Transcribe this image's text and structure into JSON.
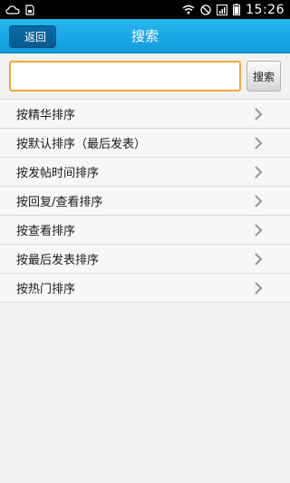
{
  "status_bar": {
    "time": "15:26",
    "icons": [
      "cloud-icon",
      "sim-icon",
      "wifi-icon",
      "do-not-disturb-icon",
      "signal-icon",
      "battery-icon"
    ]
  },
  "nav": {
    "back_label": "返回",
    "title": "搜索"
  },
  "search": {
    "value": "",
    "placeholder": "",
    "button_label": "搜索"
  },
  "sort_options": [
    {
      "label": "按精华排序"
    },
    {
      "label": "按默认排序（最后发表）"
    },
    {
      "label": "按发帖时间排序"
    },
    {
      "label": "按回复/查看排序"
    },
    {
      "label": "按查看排序"
    },
    {
      "label": "按最后发表排序"
    },
    {
      "label": "按热门排序"
    }
  ],
  "colors": {
    "nav_bg": "#1aa8e6",
    "input_border": "#f0a93c",
    "background": "#f2f2f2"
  }
}
